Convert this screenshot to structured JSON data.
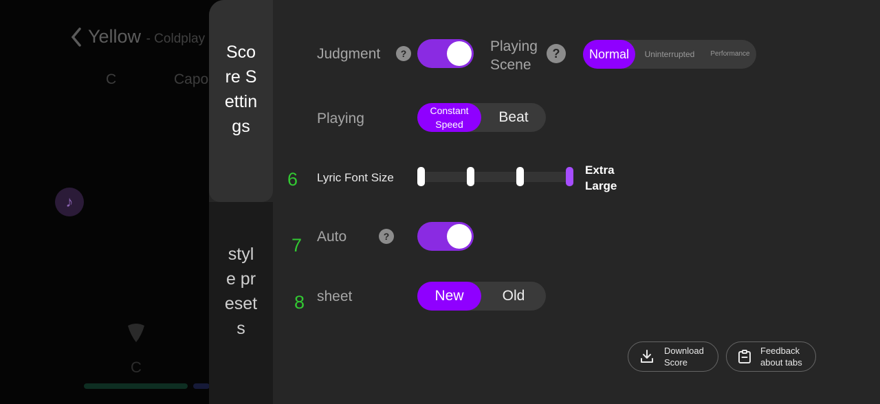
{
  "background": {
    "song_title": "Yellow",
    "artist": "- Coldplay",
    "key_label": "C",
    "capo_label": "Capo",
    "chord_label": "C"
  },
  "tabs": [
    {
      "label": "Score Settings",
      "active": true
    },
    {
      "label": "style presets",
      "active": false
    }
  ],
  "settings": {
    "judgment": {
      "label": "Judgment",
      "toggle_on": true
    },
    "playing_scene": {
      "label": "Playing Scene",
      "options": [
        "Normal",
        "Uninterrupted",
        "Performance"
      ],
      "selected": "Normal"
    },
    "playing": {
      "label": "Playing",
      "options": [
        "Constant Speed",
        "Beat"
      ],
      "selected": "Constant Speed"
    },
    "lyric_font_size": {
      "number": "6",
      "label": "Lyric Font Size",
      "value": "Extra Large",
      "level": 4,
      "levels": 4
    },
    "auto": {
      "number": "7",
      "label": "Auto",
      "toggle_on": true
    },
    "sheet": {
      "number": "8",
      "label": "sheet",
      "options": [
        "New",
        "Old"
      ],
      "selected": "New"
    }
  },
  "actions": {
    "download": "Download Score",
    "feedback": "Feedback about tabs"
  },
  "colors": {
    "accent": "#8f00ff",
    "toggle": "#8a2be2",
    "number": "#32c832"
  }
}
